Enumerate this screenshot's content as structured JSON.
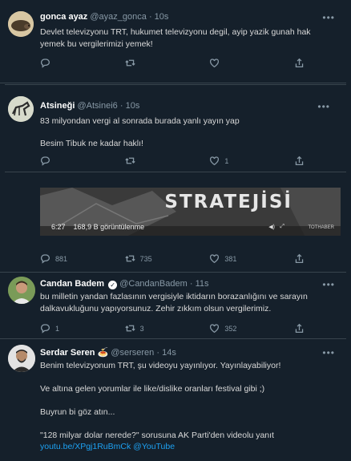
{
  "tweets": [
    {
      "name": "gonca ayaz",
      "handle": "@ayaz_gonca",
      "time": "10s",
      "text": "Devlet televizyonu TRT, hukumet televizyonu degil, ayip yazik gunah hak yemek bu vergilerimizi yemek!",
      "replies": "",
      "retweets": "",
      "likes": ""
    },
    {
      "name": "Atsineği",
      "handle": "@Atsinei6",
      "time": "10s",
      "text_line1": "83 milyondan vergi al sonrada burada yanlı yayın yap",
      "text_line2": "Besim Tibuk ne kadar haklı!",
      "replies": "",
      "retweets": "",
      "likes": "1"
    },
    {
      "video_title": "STRATEJİSİ",
      "video_duration": "6:27",
      "video_views": "168,9 B görüntülenme",
      "video_logo": "TOTHABER",
      "replies": "881",
      "retweets": "735",
      "likes": "381"
    },
    {
      "name": "Candan Badem",
      "verified_badge": "✓",
      "handle": "@CandanBadem",
      "time": "11s",
      "text": "bu milletin yandan fazlasının vergisiyle iktidarın borazanlığını ve sarayın dalkavukluğunu yapıyorsunuz. Zehir zıkkım olsun vergilerimiz.",
      "replies": "1",
      "retweets": "3",
      "likes": "352"
    },
    {
      "name": "Serdar Seren",
      "name_emoji": "🍝",
      "handle": "@serseren",
      "time": "14s",
      "line1": "Benim televizyonum TRT, şu videoyu yayınlıyor. Yayınlayabiliyor!",
      "line2": "Ve altına gelen yorumlar ile like/dislike oranları festival gibi ;)",
      "line3": "Buyrun bi göz atın...",
      "line4": "\"128 milyar dolar nerede?\" sorusuna AK Parti'den videolu yanıt",
      "link1": "youtu.be/XPgj1RuBmCk",
      "link2": "@YouTube"
    }
  ],
  "more_label": "•••",
  "separator": "·",
  "colors": {
    "background": "#15202b",
    "border": "#38444d",
    "text": "#d9d9d9",
    "muted": "#8899a6",
    "link": "#1da1f2"
  }
}
